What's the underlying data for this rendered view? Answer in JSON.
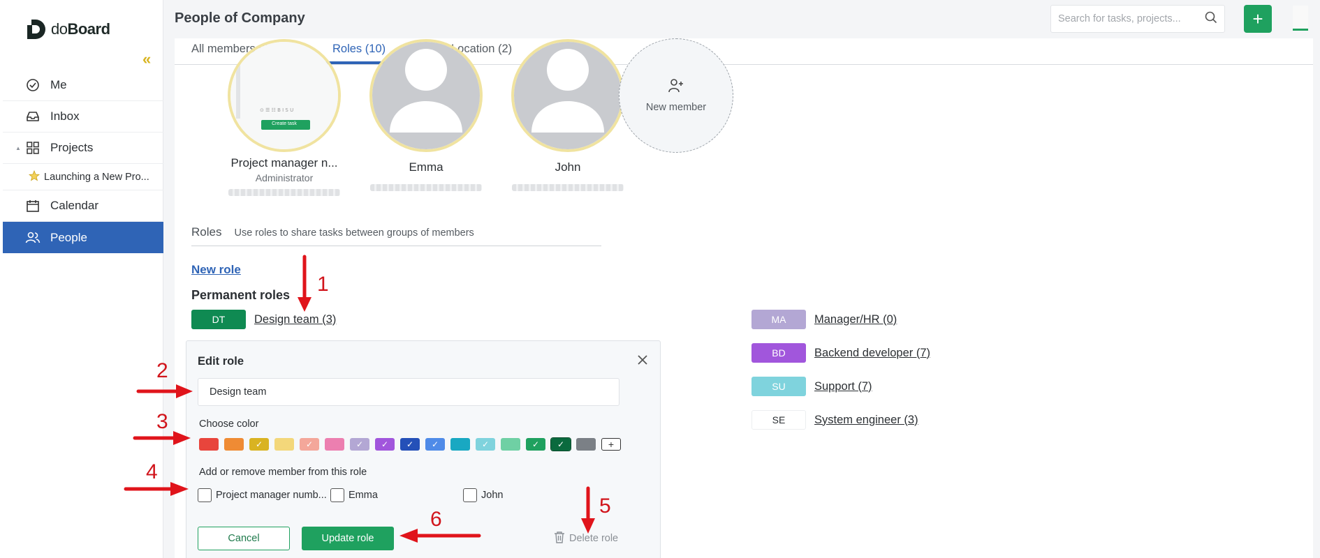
{
  "sidebar": {
    "logo": {
      "prefix": "do",
      "suffix": "Board"
    },
    "items": [
      {
        "label": "Me",
        "icon": "check-circle-icon"
      },
      {
        "label": "Inbox",
        "icon": "inbox-icon"
      },
      {
        "label": "Projects",
        "icon": "grid-icon"
      },
      {
        "label": "Launching a New Pro...",
        "icon": "star-icon"
      },
      {
        "label": "Calendar",
        "icon": "calendar-icon"
      },
      {
        "label": "People",
        "icon": "people-icon"
      }
    ]
  },
  "header": {
    "title": "People of Company",
    "search_placeholder": "Search for tasks, projects...",
    "add_label": "+"
  },
  "tabs": [
    {
      "label": "All members (3)"
    },
    {
      "label": "Roles (10)"
    },
    {
      "label": "Location (2)"
    }
  ],
  "members": [
    {
      "name": "Project manager n...",
      "role": "Administrator",
      "create_task": "Create task"
    },
    {
      "name": "Emma",
      "role": ""
    },
    {
      "name": "John",
      "role": ""
    }
  ],
  "new_member_label": "New member",
  "roles_section": {
    "title": "Roles",
    "description": "Use roles to share tasks between groups of members",
    "new_role": "New role",
    "permanent_title": "Permanent roles"
  },
  "roles": [
    {
      "abbr": "DT",
      "label": "Design team (3)",
      "color": "#0f8a52"
    },
    {
      "abbr": "MA",
      "label": "Manager/HR (0)",
      "color": "#b3a7d4"
    },
    {
      "abbr": "BD",
      "label": "Backend developer (7)",
      "color": "#a156dc"
    },
    {
      "abbr": "SU",
      "label": "Support (7)",
      "color": "#7fd3dd"
    },
    {
      "abbr": "SE",
      "label": "System engineer (3)",
      "color": "#ffffff"
    }
  ],
  "edit_role": {
    "title": "Edit role",
    "name_value": "Design team",
    "choose_color": "Choose color",
    "members_label": "Add or remove member from this role",
    "members": [
      "Project manager numb...",
      "Emma",
      "John"
    ],
    "cancel": "Cancel",
    "update": "Update role",
    "delete": "Delete role",
    "colors": [
      {
        "hex": "#e8453c",
        "checked": false
      },
      {
        "hex": "#ef8b34",
        "checked": false
      },
      {
        "hex": "#d9b322",
        "checked": true
      },
      {
        "hex": "#f3d77a",
        "checked": false
      },
      {
        "hex": "#f4a79a",
        "checked": true
      },
      {
        "hex": "#ec7fb0",
        "checked": false
      },
      {
        "hex": "#b3a7d4",
        "checked": true
      },
      {
        "hex": "#a156dc",
        "checked": true
      },
      {
        "hex": "#2450b8",
        "checked": true
      },
      {
        "hex": "#4f8be8",
        "checked": true
      },
      {
        "hex": "#19a8c2",
        "checked": false
      },
      {
        "hex": "#7fd3dd",
        "checked": true
      },
      {
        "hex": "#6fd0a4",
        "checked": false
      },
      {
        "hex": "#1fa15f",
        "checked": true
      },
      {
        "hex": "#0a6a3e",
        "checked": true
      },
      {
        "hex": "#7b8086",
        "checked": false
      }
    ],
    "add_color": "+"
  },
  "annotations": [
    "1",
    "2",
    "3",
    "4",
    "5",
    "6"
  ]
}
